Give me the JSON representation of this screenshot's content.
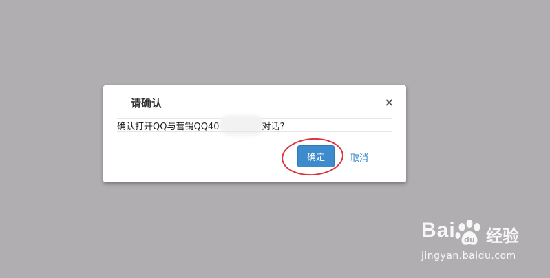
{
  "dialog": {
    "title": "请确认",
    "close_label": "×",
    "message_prefix": "确认打开QQ与营销QQ40",
    "message_suffix": "对话?",
    "confirm_label": "确定",
    "cancel_label": "取消"
  },
  "watermark": {
    "brand_left": "Bai",
    "brand_cn": "经验",
    "url": "jingyan.baidu.com"
  },
  "colors": {
    "overlay": "#b0aeb0",
    "confirm_button": "#3d8bcc",
    "cancel_link": "#2a83c4",
    "highlight_ring": "#d9343b"
  }
}
